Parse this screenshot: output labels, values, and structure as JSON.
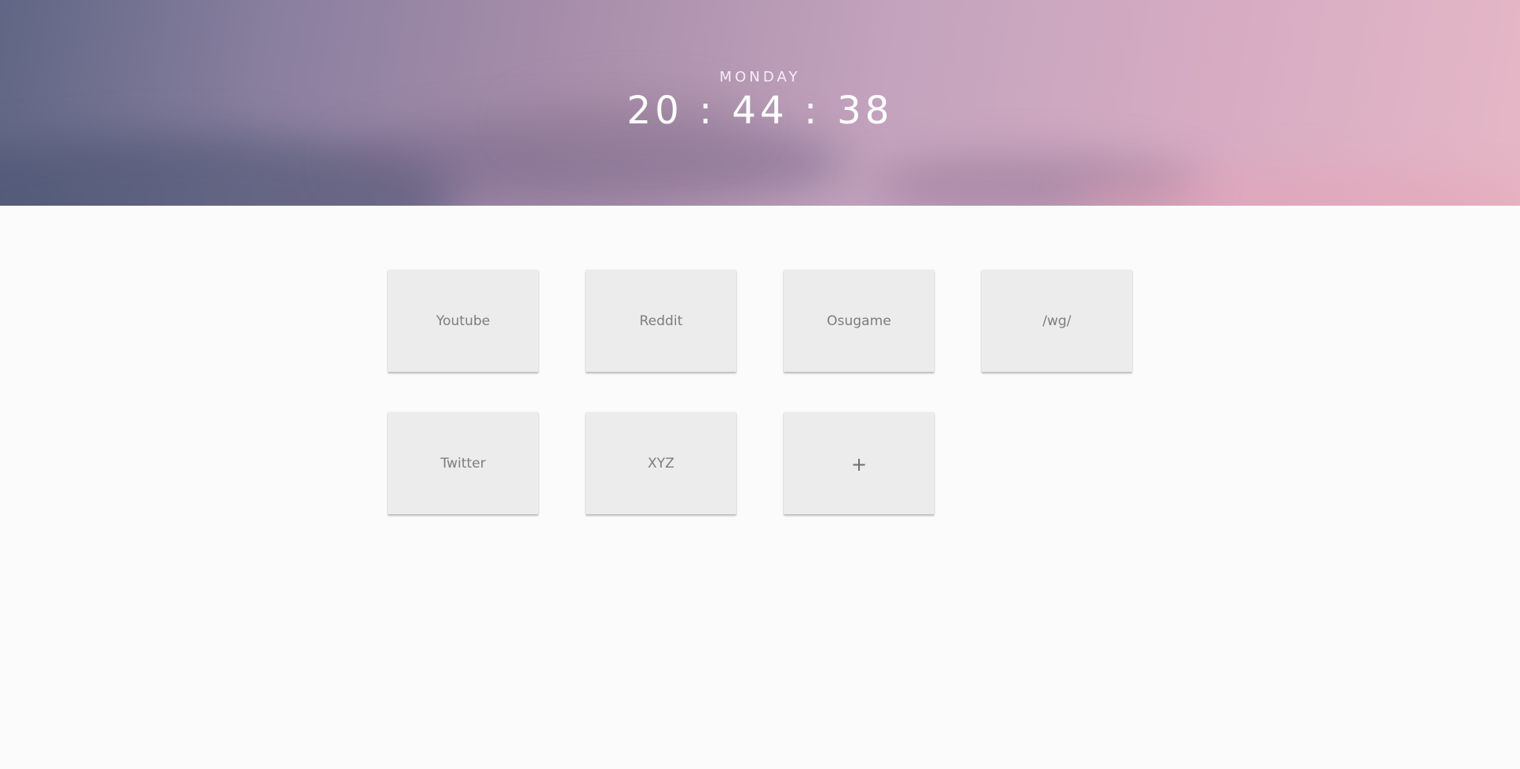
{
  "clock": {
    "day": "MONDAY",
    "time": "20 : 44 : 38"
  },
  "tiles": [
    {
      "label": "Youtube"
    },
    {
      "label": "Reddit"
    },
    {
      "label": "Osugame"
    },
    {
      "label": "/wg/"
    },
    {
      "label": "Twitter"
    },
    {
      "label": "XYZ"
    }
  ],
  "add_tile": {
    "label": "+"
  },
  "colors": {
    "page_background": "#fbfbfb",
    "tile_background": "#ececec",
    "tile_text": "#7d7d7d",
    "clock_text": "#ffffff"
  }
}
